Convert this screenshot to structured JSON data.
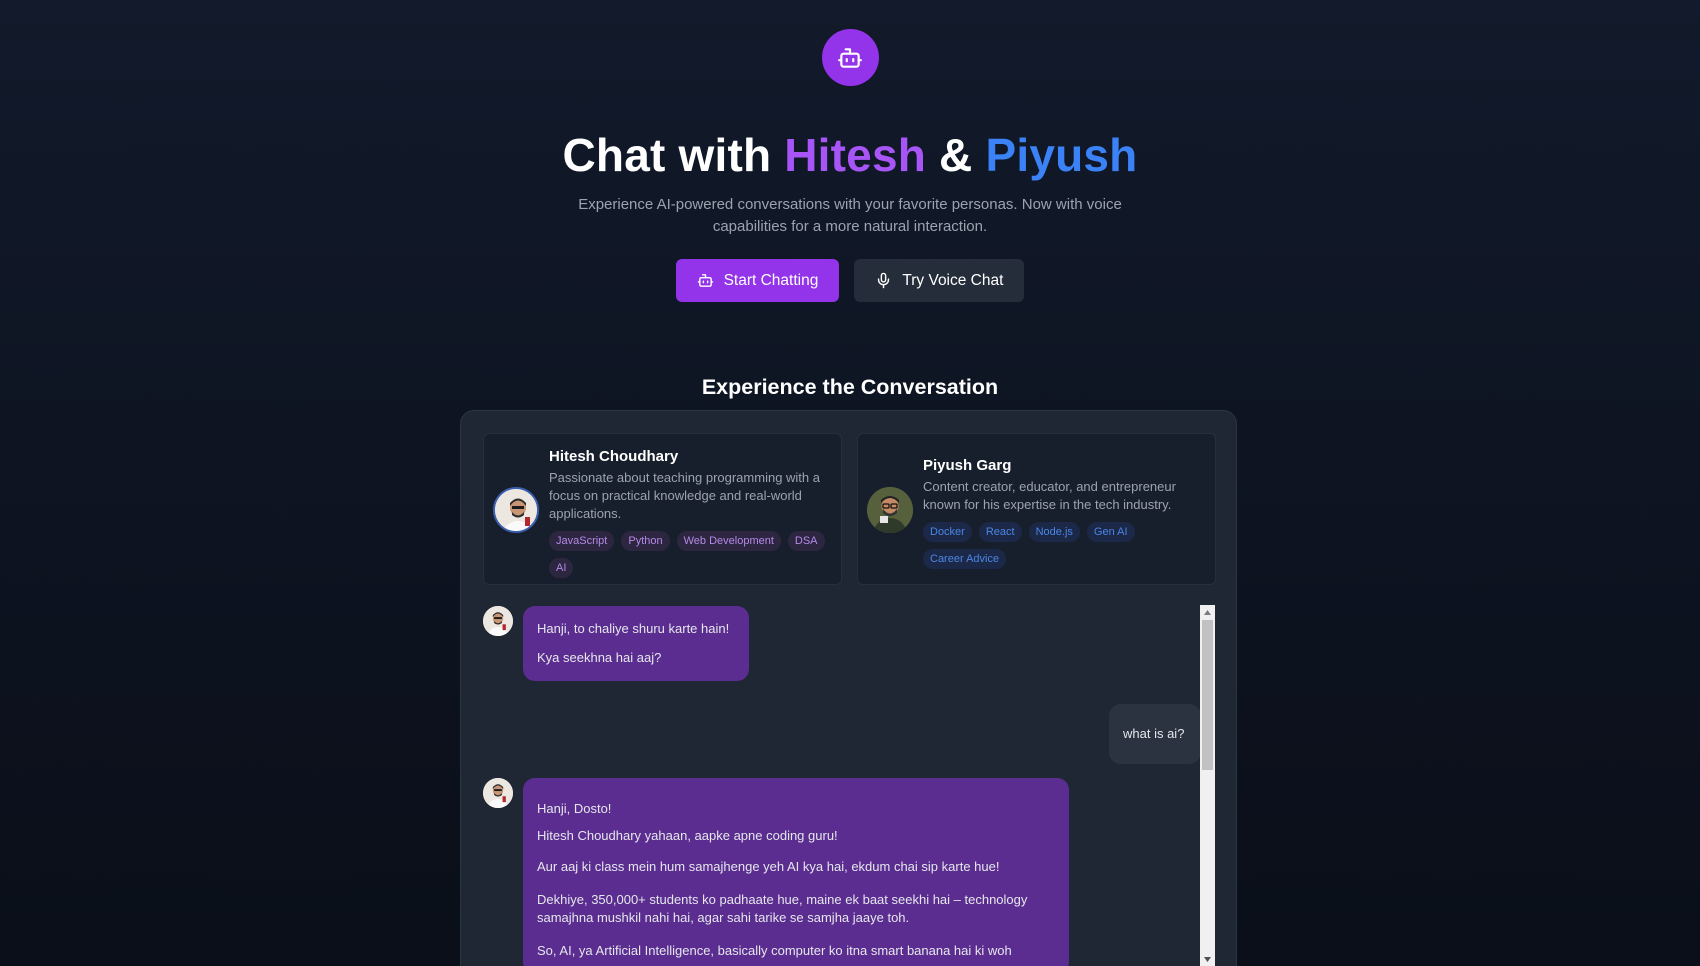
{
  "hero": {
    "title_prefix": "Chat with ",
    "title_name1": "Hitesh",
    "title_amp": " & ",
    "title_name2": "Piyush",
    "subtitle": "Experience AI-powered conversations with your favorite personas. Now with voice capabilities for a more natural interaction.",
    "start_label": "Start Chatting",
    "voice_label": "Try Voice Chat"
  },
  "section": {
    "title": "Experience the Conversation"
  },
  "personas": [
    {
      "name": "Hitesh Choudhary",
      "description": "Passionate about teaching programming with a focus on practical knowledge and real-world applications.",
      "tags": [
        "JavaScript",
        "Python",
        "Web Development",
        "DSA",
        "AI"
      ]
    },
    {
      "name": "Piyush Garg",
      "description": "Content creator, educator, and entrepreneur known for his expertise in the tech industry.",
      "tags": [
        "Docker",
        "React",
        "Node.js",
        "Gen AI",
        "Career Advice"
      ]
    }
  ],
  "messages": [
    {
      "role": "bot",
      "lines": [
        "Hanji, to chaliye shuru karte hain!",
        "Kya seekhna hai aaj?"
      ]
    },
    {
      "role": "user",
      "lines": [
        "what is ai?"
      ]
    },
    {
      "role": "bot",
      "lines": [
        "Hanji, Dosto!",
        "Hitesh Choudhary yahaan, aapke apne coding guru!",
        "Aur aaj ki class mein hum samajhenge yeh AI kya hai, ekdum chai sip karte hue!",
        "Dekhiye,  350,000+ students ko padhaate hue, maine ek baat seekhi hai –  technology samajhna mushkil nahi hai, agar sahi tarike se samjha jaaye toh.",
        "So, AI, ya Artificial Intelligence,  basically computer ko itna smart banana hai ki woh"
      ]
    }
  ],
  "colors": {
    "accent_purple": "#9333ea",
    "hitesh": "#a855f7",
    "piyush": "#3b82f6"
  },
  "icons": {
    "logo": "bot-icon",
    "start": "bot-icon",
    "voice": "mic-icon"
  }
}
